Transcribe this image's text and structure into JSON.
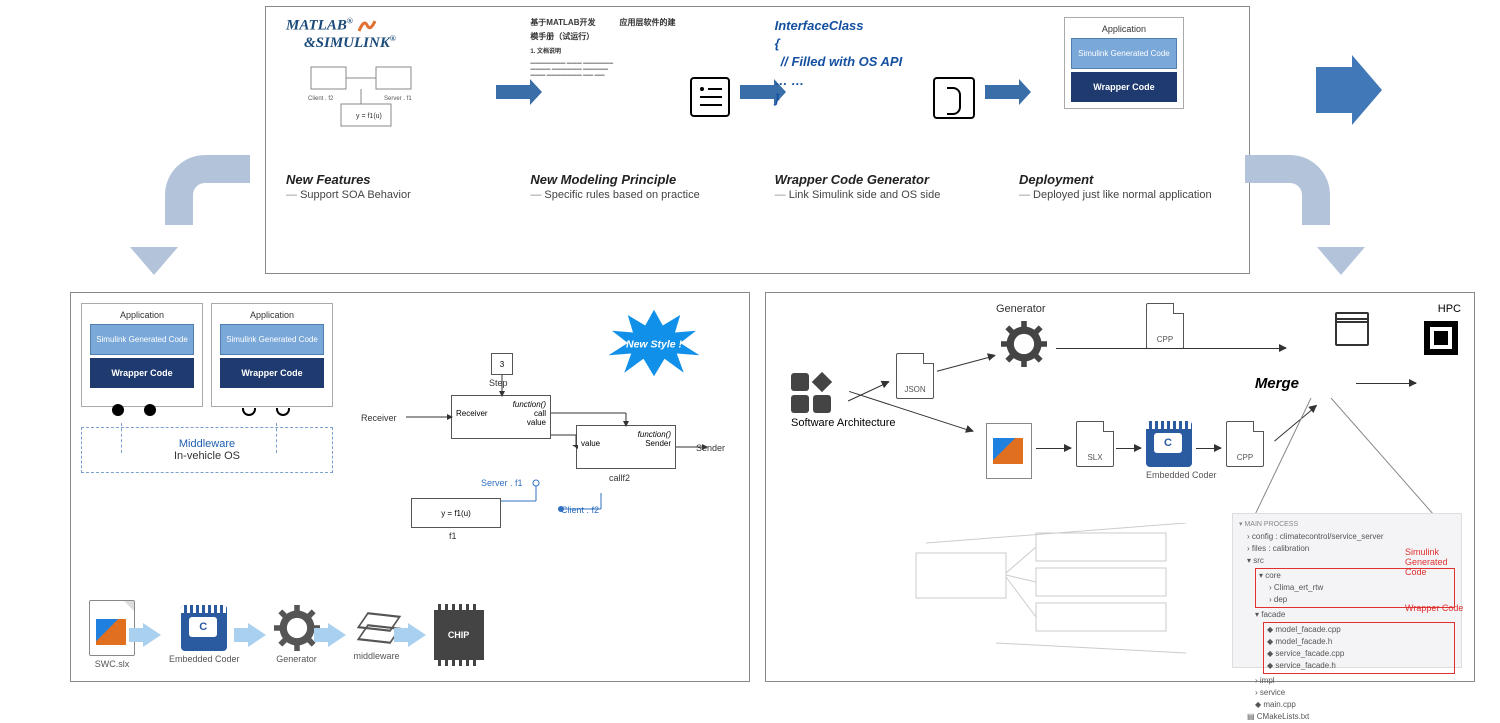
{
  "top": {
    "brand1": "MATLAB",
    "brand2": "&SIMULINK",
    "reg": "®",
    "doc_title": "基于MATLAB开发　　　应用层软件的建",
    "doc_title2": "模手册（试运行）",
    "doc_sec": "1. 文档说明",
    "interface_l1": "InterfaceClass",
    "interface_l2": "{",
    "interface_l3": "// Filled with OS API",
    "interface_l4": "… …",
    "interface_l5": "}",
    "app_title": "Application",
    "sim_gen": "Simulink Generated Code",
    "wrapper": "Wrapper Code",
    "labels": [
      {
        "title": "New Features",
        "sub": "Support SOA Behavior"
      },
      {
        "title": "New Modeling Principle",
        "sub": "Specific rules based on practice"
      },
      {
        "title": "Wrapper Code Generator",
        "sub": "Link Simulink side and OS side"
      },
      {
        "title": "Deployment",
        "sub": "Deployed just like normal application"
      }
    ]
  },
  "left": {
    "app_title": "Application",
    "sim_gen": "Simulink Generated Code",
    "wrapper": "Wrapper Code",
    "mw1": "Middleware",
    "mw2": "In-vehicle OS",
    "new_style": "New Style !",
    "nodes": {
      "step": "Step",
      "step_num": "3",
      "receiver": "Receiver",
      "sender": "Sender",
      "func": "function()",
      "call": "call",
      "value": "value",
      "callf2": "callf2",
      "server_f1": "Server . f1",
      "client_f2": "Client . f2",
      "yf1u": "y = f1(u)",
      "f1": "f1"
    },
    "flow": {
      "swc": "SWC.slx",
      "coder": "Embedded Coder",
      "generator": "Generator",
      "middleware": "middleware",
      "chip": "CHIP"
    }
  },
  "right": {
    "sa": "Software Architecture",
    "json": "JSON",
    "slx": "SLX",
    "cpp": "CPP",
    "generator": "Generator",
    "coder": "Embedded Coder",
    "merge": "Merge",
    "hpc": "HPC",
    "tree": {
      "main": "MAIN PROCESS",
      "config": "config : climatecontrol/service_server",
      "files": "files : calibration",
      "src": "src",
      "core": "core",
      "clima": "Clima_ert_rtw",
      "dep": "dep",
      "facade": "facade",
      "f1": "model_facade.cpp",
      "f2": "model_facade.h",
      "f3": "service_facade.cpp",
      "f4": "service_facade.h",
      "impl": "impl",
      "service": "service",
      "maincpp": "main.cpp",
      "cmake": "CMakeLists.txt"
    },
    "red1": "Simulink Generated Code",
    "red2": "Wrapper Code"
  }
}
